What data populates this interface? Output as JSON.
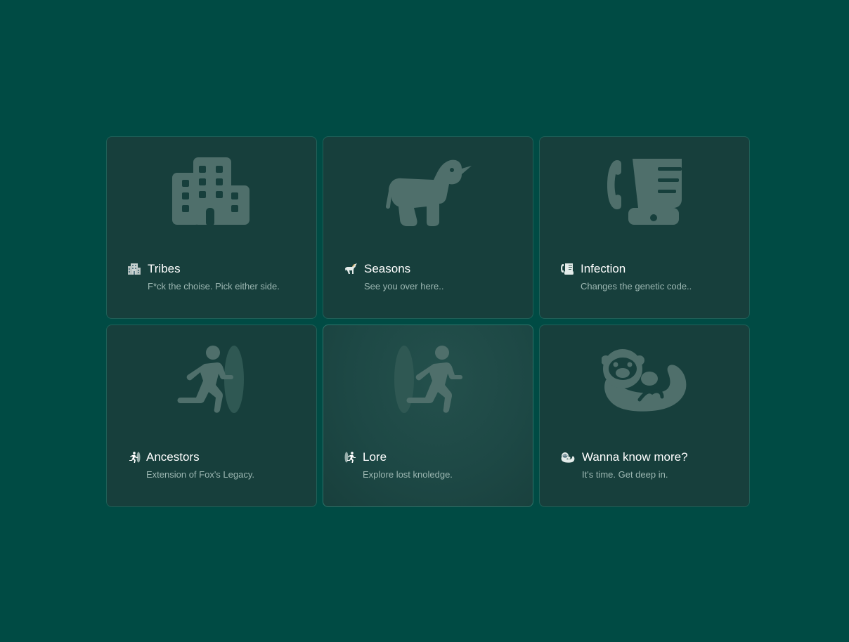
{
  "colors": {
    "background": "#004b44",
    "card": "#173f3c",
    "card_border": "#1f6058",
    "icon_large": "#4f6f6b",
    "title": "#ffffff",
    "description": "#9cb7b2"
  },
  "cards": [
    {
      "icon": "office-building-icon",
      "title": "Tribes",
      "description": "F*ck the choise. Pick either side."
    },
    {
      "icon": "unicorn-icon",
      "title": "Seasons",
      "description": "See you over here.."
    },
    {
      "icon": "fax-machine-icon",
      "title": "Infection",
      "description": "Changes the genetic code.."
    },
    {
      "icon": "person-running-out-of-portal-icon",
      "title": "Ancestors",
      "description": "Extension of Fox's Legacy."
    },
    {
      "icon": "person-running-into-portal-icon",
      "title": "Lore",
      "description": "Explore lost knoledge."
    },
    {
      "icon": "otter-icon",
      "title": "Wanna know more?",
      "description": "It's time. Get deep in."
    }
  ]
}
